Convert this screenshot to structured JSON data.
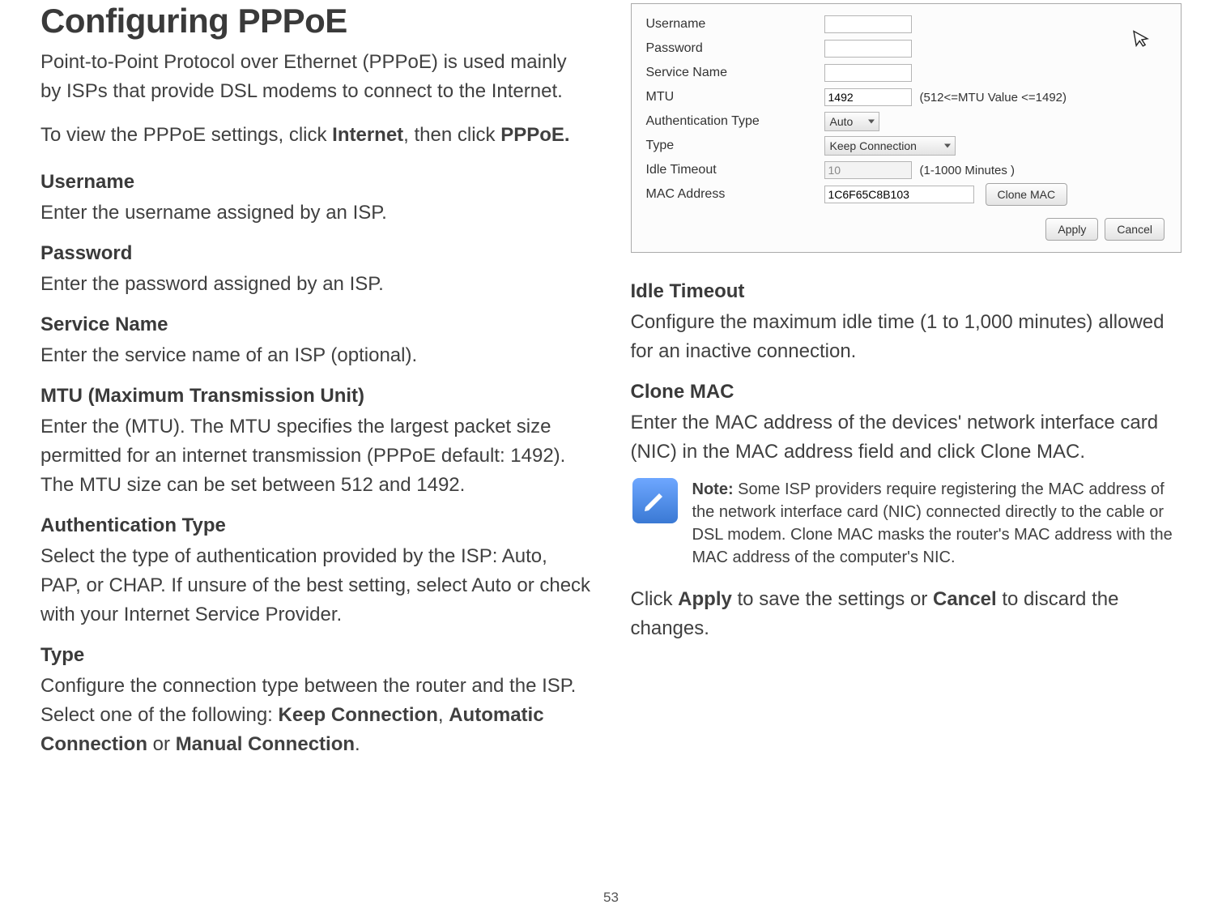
{
  "page_number": "53",
  "left": {
    "title": "Configuring PPPoE",
    "intro": "Point-to-Point Protocol over Ethernet (PPPoE) is used mainly by ISPs that provide DSL modems to connect to the Internet.",
    "nav_prefix": "To view the PPPoE settings, click ",
    "nav_b1": "Internet",
    "nav_mid": ", then click ",
    "nav_b2": "PPPoE.",
    "sections": {
      "username_h": "Username",
      "username_b": "Enter the username assigned by an ISP.",
      "password_h": "Password",
      "password_b": "Enter the password assigned by an ISP.",
      "service_h": "Service Name",
      "service_b": "Enter the service name of an ISP (optional).",
      "mtu_h": "MTU (Maximum Transmission Unit)",
      "mtu_b": "Enter the (MTU). The MTU specifies the largest packet size permitted for an internet transmission (PPPoE default: 1492). The MTU size can be set between 512 and 1492.",
      "auth_h": "Authentication Type",
      "auth_b": "Select the type of authentication provided by the ISP: Auto, PAP, or CHAP. If unsure of the best setting, select Auto or check with your Internet Service Provider.",
      "type_h": "Type",
      "type_b1": "Configure the connection type between the router and the ISP. Select one of the following: ",
      "type_b_kc": "Keep Connection",
      "type_b_sep1": ", ",
      "type_b_ac": "Automatic Connection",
      "type_b_sep2": " or ",
      "type_b_mc": "Manual Connection",
      "type_b_end": "."
    }
  },
  "panel": {
    "labels": {
      "username": "Username",
      "password": "Password",
      "service": "Service Name",
      "mtu": "MTU",
      "auth": "Authentication Type",
      "type": "Type",
      "idle": "Idle Timeout",
      "mac": "MAC Address"
    },
    "values": {
      "username": "",
      "password": "",
      "service": "",
      "mtu": "1492",
      "mtu_hint": "(512<=MTU Value <=1492)",
      "auth": "Auto",
      "type": "Keep Connection",
      "idle": "10",
      "idle_hint": "(1-1000 Minutes )",
      "mac": "1C6F65C8B103"
    },
    "buttons": {
      "clone": "Clone MAC",
      "apply": "Apply",
      "cancel": "Cancel"
    }
  },
  "right": {
    "idle_h": "Idle Timeout",
    "idle_b": "Configure the maximum idle time (1 to 1,000 minutes) allowed for an inactive connection.",
    "clone_h": "Clone MAC",
    "clone_b": "Enter the MAC address of the devices' network interface card (NIC) in the MAC address field and click Clone MAC.",
    "note_label": "Note:",
    "note_text": " Some ISP providers require registering the MAC address of the network interface card (NIC) connected directly to the cable or DSL modem. Clone MAC masks the router's MAC address with the MAC address of the computer's NIC.",
    "apply_prefix": "Click ",
    "apply_b1": "Apply",
    "apply_mid": " to save the settings or ",
    "apply_b2": "Cancel",
    "apply_suffix": " to discard the changes."
  }
}
